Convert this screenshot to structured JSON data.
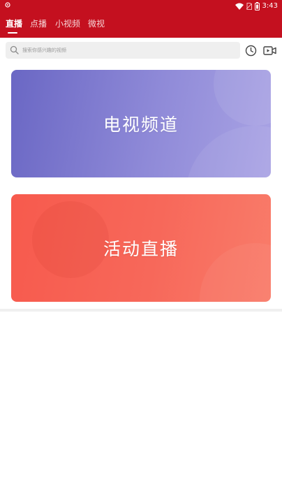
{
  "status_bar": {
    "time": "3:43",
    "icons": [
      "notification-icon",
      "wifi-icon",
      "no-sim-icon",
      "battery-icon"
    ]
  },
  "tabs": [
    {
      "label": "直播",
      "active": true
    },
    {
      "label": "点播",
      "active": false
    },
    {
      "label": "小视频",
      "active": false
    },
    {
      "label": "微视",
      "active": false
    }
  ],
  "search": {
    "placeholder": "搜索你感兴趣的视频",
    "icon": "search-icon"
  },
  "toolbar": {
    "history_icon": "clock-icon",
    "video_icon": "video-camera-icon"
  },
  "cards": {
    "tv_channels": {
      "label": "电视频道"
    },
    "live_events": {
      "label": "活动直播"
    }
  },
  "colors": {
    "header": "#c4101f",
    "tv_card": "#7c78cf",
    "live_card": "#f7655a",
    "search_bg": "#efefef"
  }
}
